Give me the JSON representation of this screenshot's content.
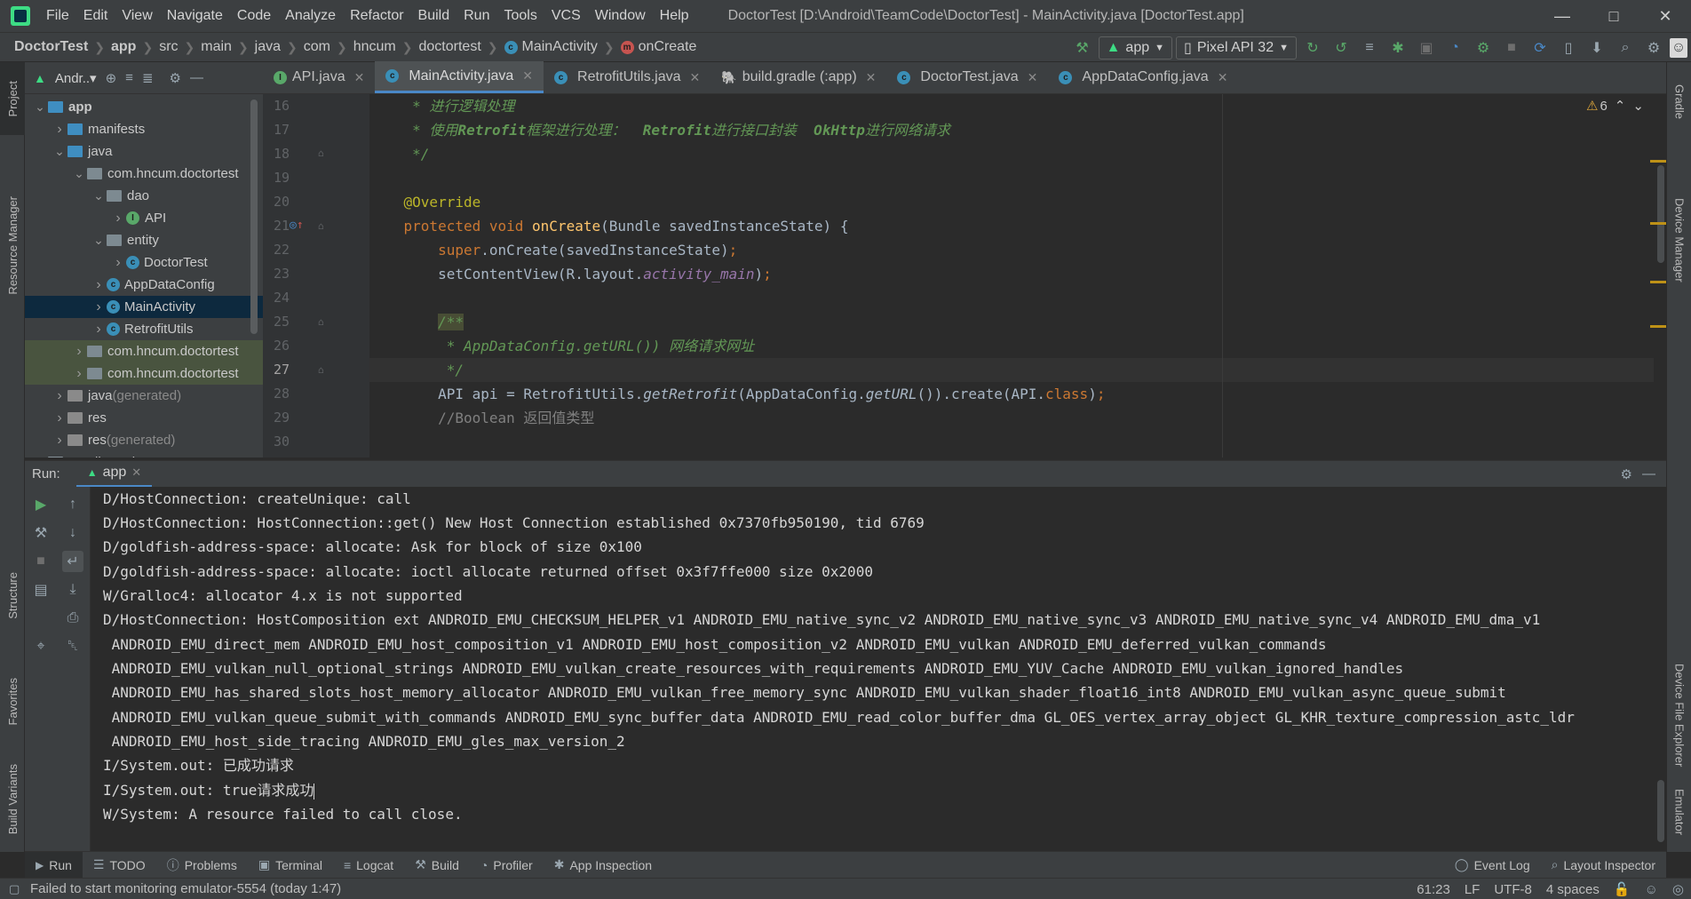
{
  "window": {
    "title": "DoctorTest [D:\\Android\\TeamCode\\DoctorTest] - MainActivity.java [DoctorTest.app]",
    "controls": [
      "minimize",
      "maximize",
      "close"
    ]
  },
  "menu": [
    "File",
    "Edit",
    "View",
    "Navigate",
    "Code",
    "Analyze",
    "Refactor",
    "Build",
    "Run",
    "Tools",
    "VCS",
    "Window",
    "Help"
  ],
  "breadcrumb": [
    "DoctorTest",
    "app",
    "src",
    "main",
    "java",
    "com",
    "hncum",
    "doctortest",
    "MainActivity",
    "onCreate"
  ],
  "toolbar": {
    "run_config": "app",
    "device": "Pixel API 32"
  },
  "left_stripe": [
    "Project",
    "Resource Manager",
    "Structure",
    "Favorites",
    "Build Variants"
  ],
  "right_stripe": [
    "Gradle",
    "Device Manager",
    "Device File Explorer",
    "Emulator"
  ],
  "project": {
    "view_label": "Andr..▾",
    "tree": [
      {
        "label": "app",
        "depth": 0,
        "icon": "module",
        "expanded": true
      },
      {
        "label": "manifests",
        "depth": 1,
        "icon": "folder-blue",
        "expanded": false
      },
      {
        "label": "java",
        "depth": 1,
        "icon": "folder-blue",
        "expanded": true
      },
      {
        "label": "com.hncum.doctortest",
        "depth": 2,
        "icon": "package",
        "expanded": true
      },
      {
        "label": "dao",
        "depth": 3,
        "icon": "package",
        "expanded": true
      },
      {
        "label": "API",
        "depth": 4,
        "icon": "interface",
        "expanded": false
      },
      {
        "label": "entity",
        "depth": 3,
        "icon": "package",
        "expanded": true
      },
      {
        "label": "DoctorTest",
        "depth": 4,
        "icon": "class",
        "expanded": false
      },
      {
        "label": "AppDataConfig",
        "depth": 3,
        "icon": "class",
        "expanded": false
      },
      {
        "label": "MainActivity",
        "depth": 3,
        "icon": "class",
        "expanded": false,
        "selected": true
      },
      {
        "label": "RetrofitUtils",
        "depth": 3,
        "icon": "class",
        "expanded": false
      },
      {
        "label": "com.hncum.doctortest",
        "depth": 2,
        "icon": "package",
        "expanded": false,
        "generated": true
      },
      {
        "label": "com.hncum.doctortest",
        "depth": 2,
        "icon": "package",
        "expanded": false,
        "generated": true
      },
      {
        "label": "java",
        "suffix": "(generated)",
        "depth": 1,
        "icon": "folder-gen",
        "expanded": false
      },
      {
        "label": "res",
        "depth": 1,
        "icon": "folder-res",
        "expanded": false
      },
      {
        "label": "res",
        "suffix": "(generated)",
        "depth": 1,
        "icon": "folder-res",
        "expanded": false
      },
      {
        "label": "Gradle Scripts",
        "depth": 0,
        "icon": "gradle",
        "expanded": false
      }
    ]
  },
  "editor": {
    "tabs": [
      {
        "label": "API.java",
        "icon": "interface"
      },
      {
        "label": "MainActivity.java",
        "icon": "class",
        "active": true
      },
      {
        "label": "RetrofitUtils.java",
        "icon": "class"
      },
      {
        "label": "build.gradle (:app)",
        "icon": "gradle"
      },
      {
        "label": "DoctorTest.java",
        "icon": "class"
      },
      {
        "label": "AppDataConfig.java",
        "icon": "class"
      }
    ],
    "warning_count": "6",
    "line_numbers": [
      "16",
      "17",
      "18",
      "19",
      "20",
      "21",
      "22",
      "23",
      "24",
      "25",
      "26",
      "27",
      "28",
      "29",
      "30"
    ],
    "current_line": "27",
    "code": {
      "l16": "     * 进行逻辑处理",
      "l17a": "     * 使用",
      "l17b": "Retrofit",
      "l17c": "框架进行处理：  ",
      "l17d": "Retrofit",
      "l17e": "进行接口封装  ",
      "l17f": "OkHttp",
      "l17g": "进行网络请求",
      "l18": "     */",
      "l20": "@Override",
      "l21a": "protected void ",
      "l21b": "onCreate",
      "l21c": "(Bundle savedInstanceState) {",
      "l22a": "super",
      "l22b": ".onCreate(savedInstanceState)",
      "l22c": ";",
      "l23a": "setContentView(R.layout.",
      "l23b": "activity_main",
      "l23c": ")",
      "l23d": ";",
      "l25": "/**",
      "l26": " * AppDataConfig.getURL()) 网络请求网址",
      "l27": " */",
      "l28a": "API api = RetrofitUtils.",
      "l28b": "getRetrofit",
      "l28c": "(AppDataConfig.",
      "l28d": "getURL",
      "l28e": "()).create(API.",
      "l28f": "class",
      "l28g": ")",
      "l28h": ";",
      "l29": "//Boolean 返回值类型"
    }
  },
  "run": {
    "label": "Run:",
    "tab": "app",
    "console": [
      "D/HostConnection: createUnique: call",
      "D/HostConnection: HostConnection::get() New Host Connection established 0x7370fb950190, tid 6769",
      "D/goldfish-address-space: allocate: Ask for block of size 0x100",
      "D/goldfish-address-space: allocate: ioctl allocate returned offset 0x3f7ffe000 size 0x2000",
      "W/Gralloc4: allocator 4.x is not supported",
      "D/HostConnection: HostComposition ext ANDROID_EMU_CHECKSUM_HELPER_v1 ANDROID_EMU_native_sync_v2 ANDROID_EMU_native_sync_v3 ANDROID_EMU_native_sync_v4 ANDROID_EMU_dma_v1",
      " ANDROID_EMU_direct_mem ANDROID_EMU_host_composition_v1 ANDROID_EMU_host_composition_v2 ANDROID_EMU_vulkan ANDROID_EMU_deferred_vulkan_commands",
      " ANDROID_EMU_vulkan_null_optional_strings ANDROID_EMU_vulkan_create_resources_with_requirements ANDROID_EMU_YUV_Cache ANDROID_EMU_vulkan_ignored_handles",
      " ANDROID_EMU_has_shared_slots_host_memory_allocator ANDROID_EMU_vulkan_free_memory_sync ANDROID_EMU_vulkan_shader_float16_int8 ANDROID_EMU_vulkan_async_queue_submit",
      " ANDROID_EMU_vulkan_queue_submit_with_commands ANDROID_EMU_sync_buffer_data ANDROID_EMU_read_color_buffer_dma GL_OES_vertex_array_object GL_KHR_texture_compression_astc_ldr",
      " ANDROID_EMU_host_side_tracing ANDROID_EMU_gles_max_version_2",
      "I/System.out: 已成功请求",
      "I/System.out: true请求成功",
      "W/System: A resource failed to call close."
    ]
  },
  "bottom_tabs": [
    "Run",
    "TODO",
    "Problems",
    "Terminal",
    "Logcat",
    "Build",
    "Profiler",
    "App Inspection"
  ],
  "bottom_right_tabs": [
    "Event Log",
    "Layout Inspector"
  ],
  "status": {
    "message": "Failed to start monitoring emulator-5554 (today 1:47)",
    "position": "61:23",
    "line_sep": "LF",
    "encoding": "UTF-8",
    "indent": "4 spaces"
  },
  "colors": {
    "accent": "#4a88c7",
    "keyword": "#cc7832",
    "method": "#ffc66d",
    "annotation": "#bbb529",
    "doc_comment": "#629755",
    "line_comment": "#808080",
    "field": "#9876aa"
  }
}
